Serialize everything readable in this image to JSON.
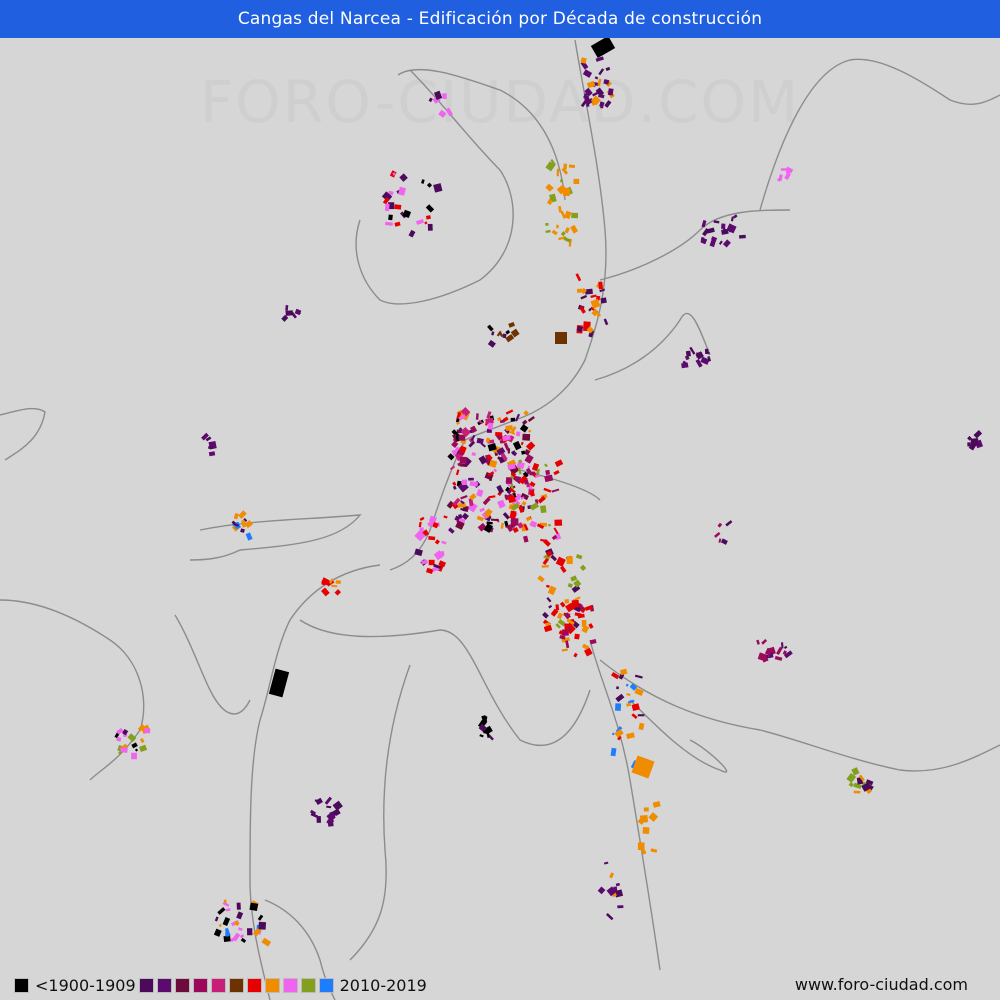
{
  "title": "Cangas del Narcea - Edificación por Década de construcción",
  "watermark": "FORO-CIUDAD.COM",
  "website": "www.foro-ciudad.com",
  "legend": {
    "first_label": "<1900-1909",
    "last_label": "2010-2019",
    "colors": [
      "#000000",
      "#4b0a5a",
      "#5c0a6e",
      "#6e0a3c",
      "#9b0a5a",
      "#c81e78",
      "#6e3200",
      "#e60000",
      "#f08c00",
      "#f064f0",
      "#82a01e",
      "#1e7dff"
    ]
  },
  "colors": {
    "header": "#1f5fe0",
    "background": "#d6d6d6",
    "road": "#8c8c8c"
  }
}
